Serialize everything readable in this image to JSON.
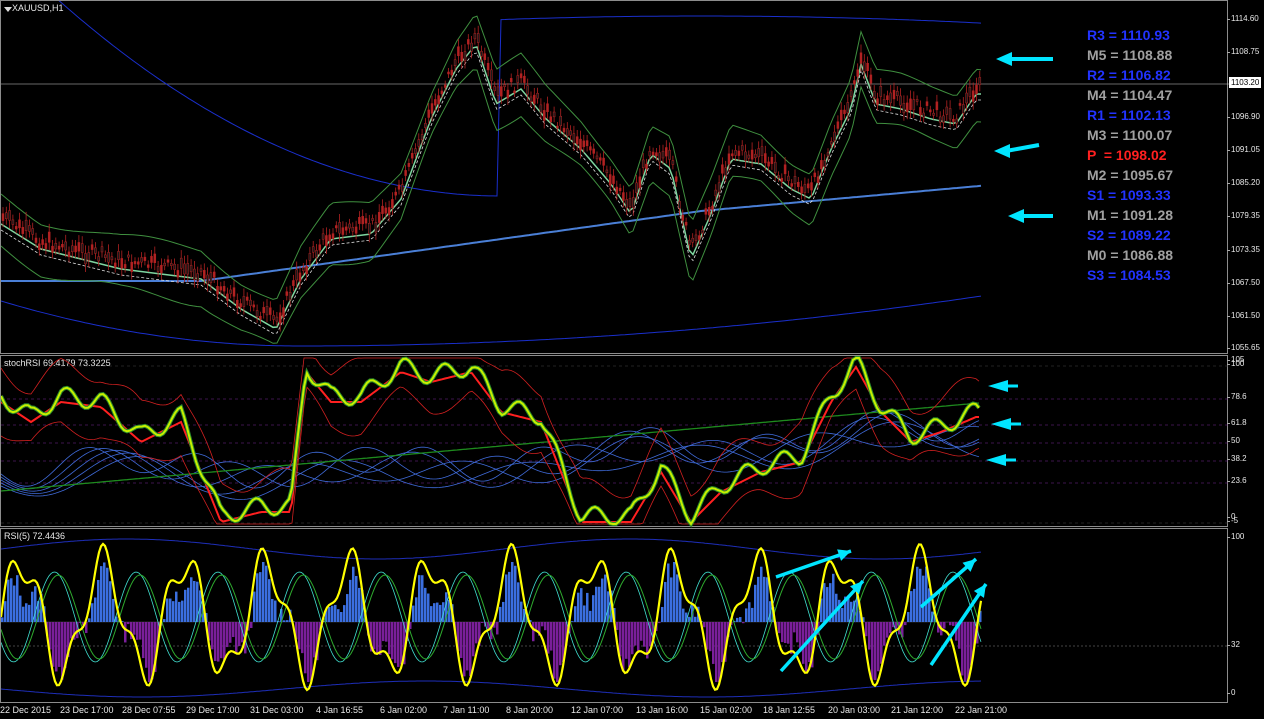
{
  "window": {
    "symbol_title": "XAUUSD,H1"
  },
  "colors": {
    "background": "#000000",
    "candle": "#b22222",
    "bollinger": "#3f8f3f",
    "envelope": "#1a2fcc",
    "ma_long": "#4a7fd6",
    "ma_fast": "#7fd6a0",
    "pivot_blue": "#2233ff",
    "pivot_gray": "#a0a0a0",
    "pivot_red": "#ff2020",
    "arrow": "#00e5ff",
    "rsi_line": "#ffff00",
    "histo_pos": "#3b6fe0",
    "histo_neg": "#7a1f9a",
    "stoch_k": "#c8f000",
    "stoch_d": "#ff2020"
  },
  "main": {
    "price_axis": [
      "1114.60",
      "1108.75",
      "1096.90",
      "1091.05",
      "1085.20",
      "1079.35",
      "1073.35",
      "1067.50",
      "1061.50",
      "1055.65"
    ],
    "current_price": "1103.20",
    "pivots": [
      {
        "label": "R3 = 1110.93",
        "color": "#2233ff"
      },
      {
        "label": "M5 = 1108.88",
        "color": "#a0a0a0"
      },
      {
        "label": "R2 = 1106.82",
        "color": "#2233ff"
      },
      {
        "label": "M4 = 1104.47",
        "color": "#a0a0a0"
      },
      {
        "label": "R1 = 1102.13",
        "color": "#2233ff"
      },
      {
        "label": "M3 = 1100.07",
        "color": "#a0a0a0"
      },
      {
        "label": "P  = 1098.02",
        "color": "#ff2020"
      },
      {
        "label": "M2 = 1095.67",
        "color": "#a0a0a0"
      },
      {
        "label": "S1 = 1093.33",
        "color": "#2233ff"
      },
      {
        "label": "M1 = 1091.28",
        "color": "#a0a0a0"
      },
      {
        "label": "S2 = 1089.22",
        "color": "#2233ff"
      },
      {
        "label": "M0 = 1086.88",
        "color": "#a0a0a0"
      },
      {
        "label": "S3 = 1084.53",
        "color": "#2233ff"
      }
    ]
  },
  "stoch": {
    "title": "stochRSI 69.4179 73.3225",
    "axis": [
      "105",
      "100",
      "78.6",
      "61.8",
      "50",
      "38.2",
      "23.6",
      "0",
      "-5"
    ]
  },
  "rsi": {
    "title": "RSI(5) 72.4436",
    "axis": [
      "100",
      "32",
      "0"
    ]
  },
  "time_axis": [
    "22 Dec 2015",
    "23 Dec 17:00",
    "28 Dec 07:55",
    "29 Dec 17:00",
    "31 Dec 03:00",
    "4 Jan 16:55",
    "6 Jan 02:00",
    "7 Jan 11:00",
    "8 Jan 20:00",
    "12 Jan 07:00",
    "13 Jan 16:00",
    "15 Jan 02:00",
    "18 Jan 12:55",
    "20 Jan 03:00",
    "21 Jan 12:00",
    "22 Jan 21:00"
  ]
}
